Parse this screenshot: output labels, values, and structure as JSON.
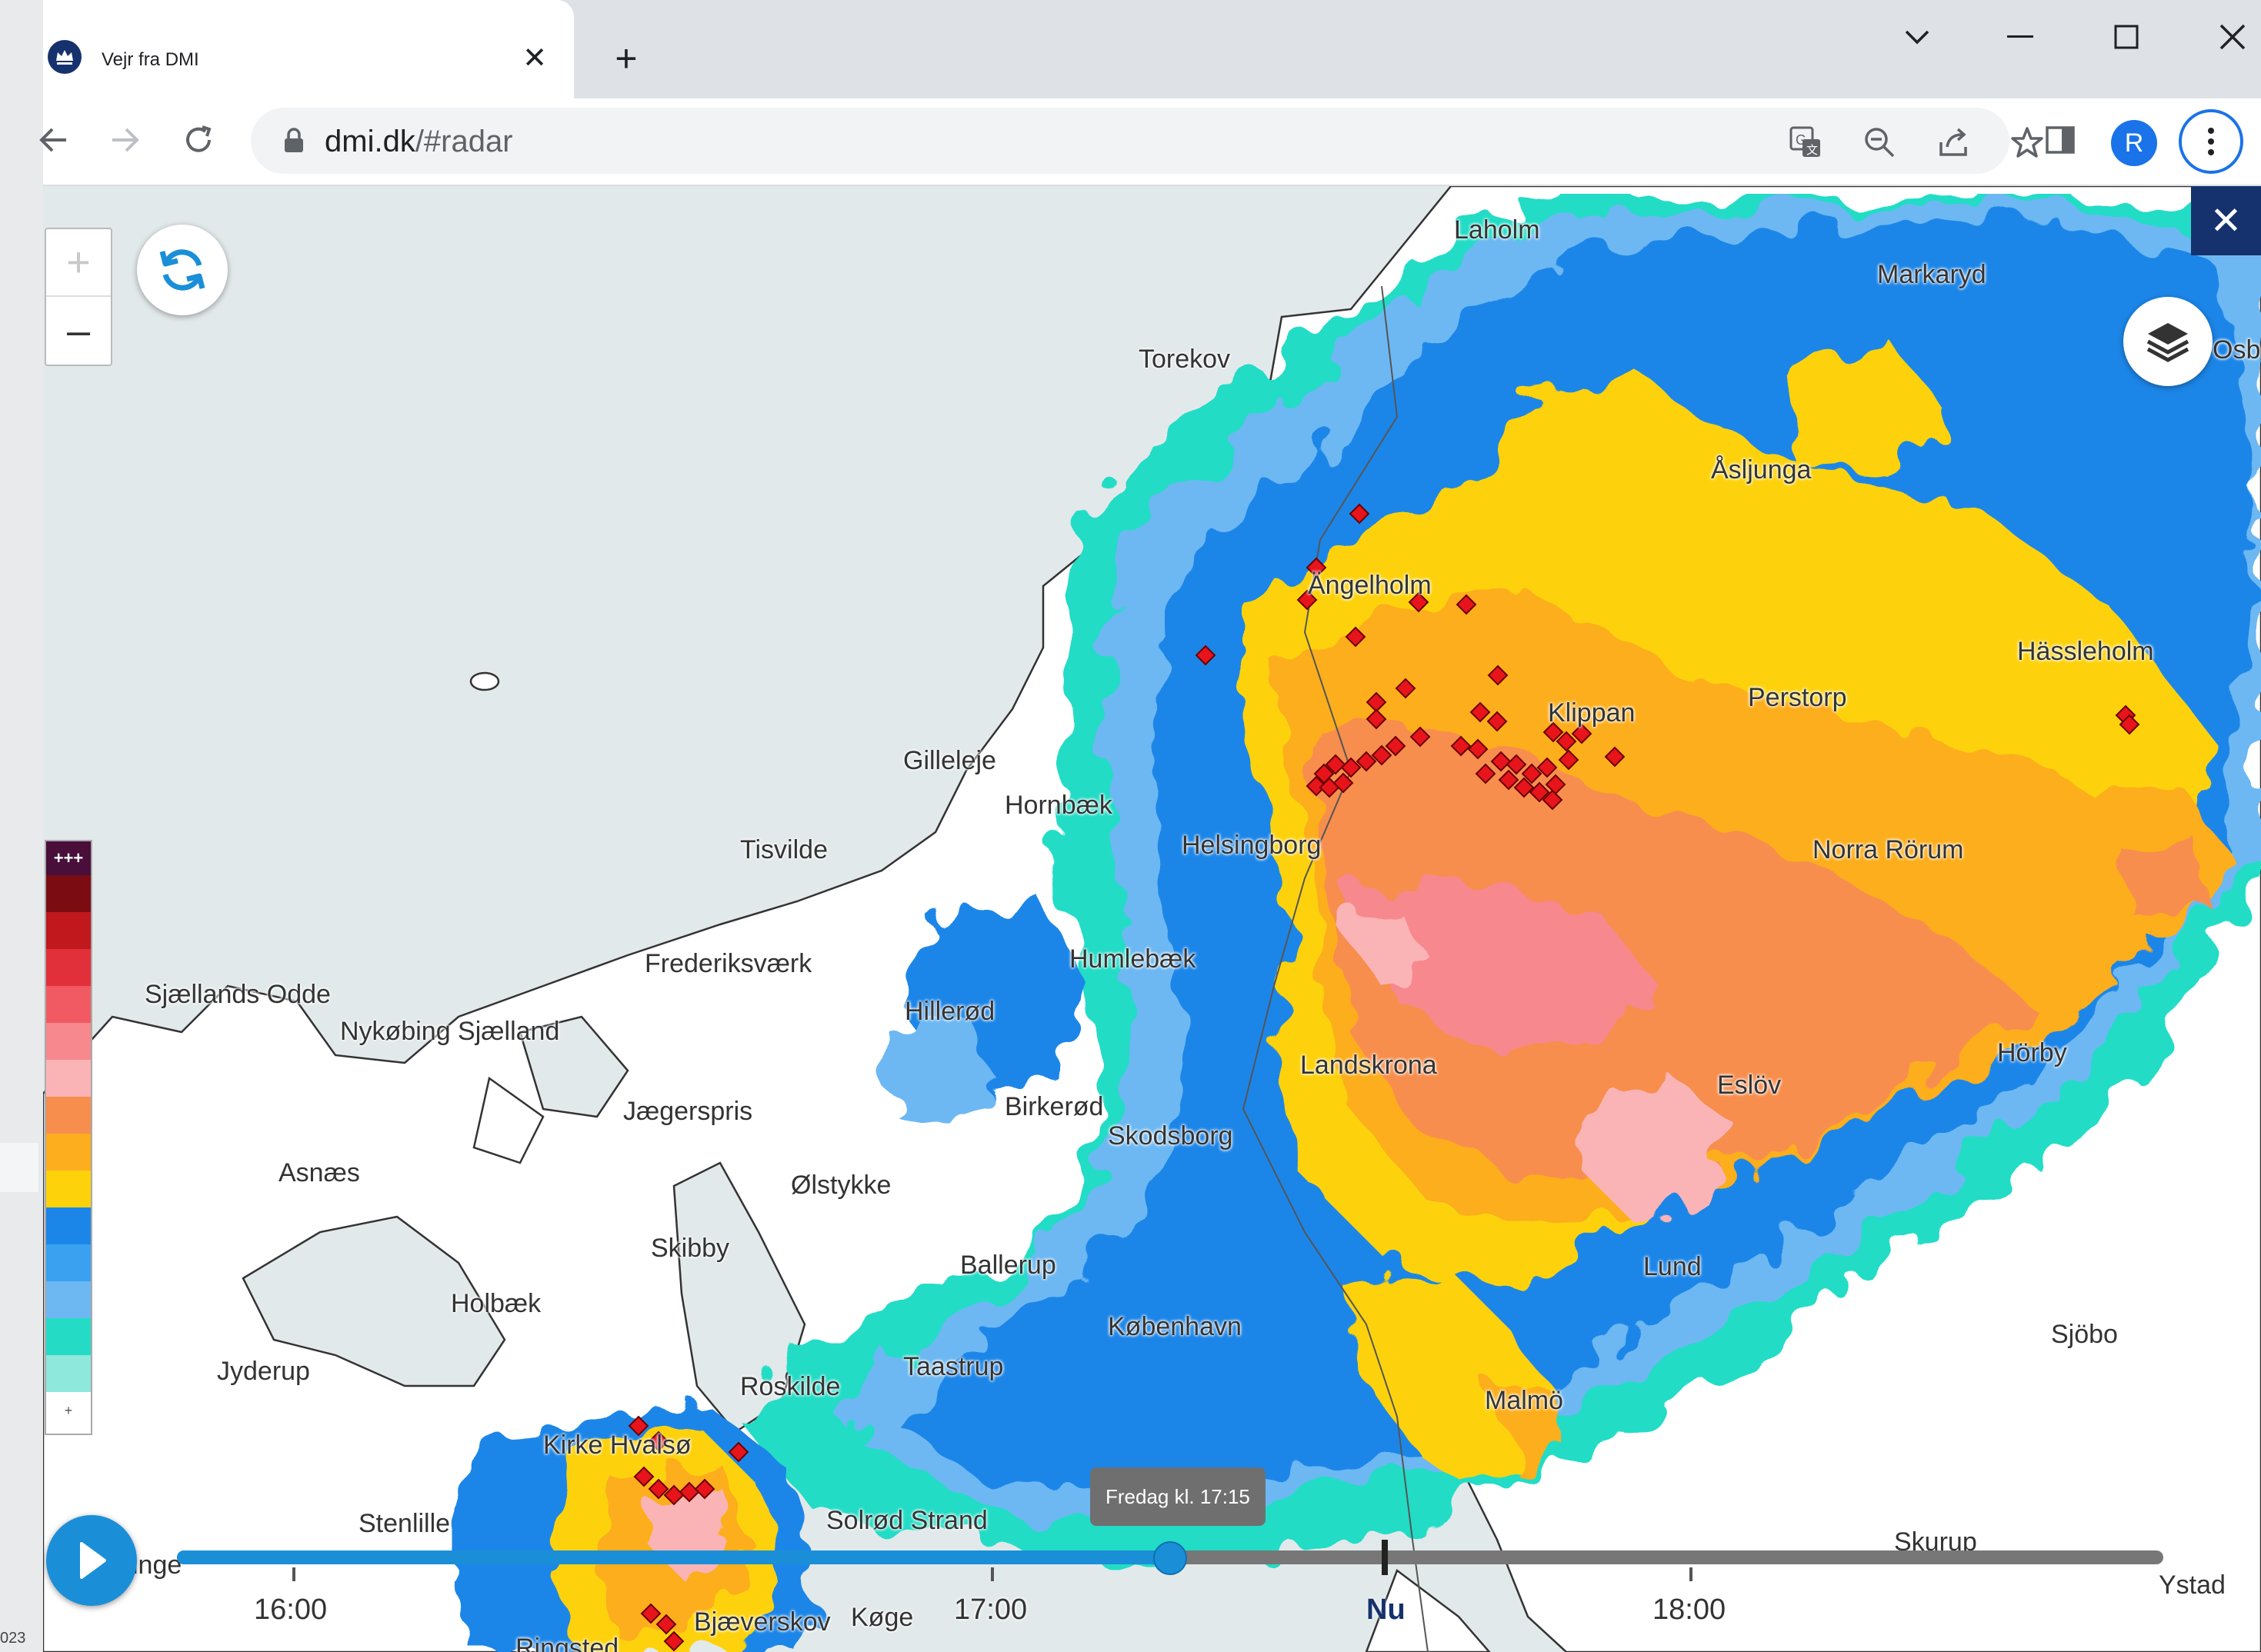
{
  "browser": {
    "tab_title": "Vejr fra DMI",
    "url_host": "dmi.dk",
    "url_path": "/#radar",
    "profile_initial": "R"
  },
  "left_edge": {
    "text": "023"
  },
  "map": {
    "places": [
      {
        "name": "Laholm"
      },
      {
        "name": "Markaryd"
      },
      {
        "name": "Torekov"
      },
      {
        "name": "Åsljunga"
      },
      {
        "name": "Ängelholm"
      },
      {
        "name": "Hässleholm"
      },
      {
        "name": "Klippan"
      },
      {
        "name": "Perstorp"
      },
      {
        "name": "Gilleleje"
      },
      {
        "name": "Hornbæk"
      },
      {
        "name": "Tisvilde"
      },
      {
        "name": "Helsingborg"
      },
      {
        "name": "Norra Rörum"
      },
      {
        "name": "Frederiksværk"
      },
      {
        "name": "Humlebæk"
      },
      {
        "name": "Sjællands Odde"
      },
      {
        "name": "Hillerød"
      },
      {
        "name": "Nykøbing Sjælland"
      },
      {
        "name": "Landskrona"
      },
      {
        "name": "Hörby"
      },
      {
        "name": "Eslöv"
      },
      {
        "name": "Jægerspris"
      },
      {
        "name": "Birkerød"
      },
      {
        "name": "Skodsborg"
      },
      {
        "name": "Asnæs"
      },
      {
        "name": "Ølstykke"
      },
      {
        "name": "Skibby"
      },
      {
        "name": "Ballerup"
      },
      {
        "name": "Lund"
      },
      {
        "name": "Holbæk"
      },
      {
        "name": "København"
      },
      {
        "name": "Sjöbo"
      },
      {
        "name": "Jyderup"
      },
      {
        "name": "Taastrup"
      },
      {
        "name": "Roskilde"
      },
      {
        "name": "Malmö"
      },
      {
        "name": "Kirke Hvalsø"
      },
      {
        "name": "Stenlille"
      },
      {
        "name": "Solrød Strand"
      },
      {
        "name": "Skurup"
      },
      {
        "name": "inge"
      },
      {
        "name": "Bjæverskov"
      },
      {
        "name": "Køge"
      },
      {
        "name": "Ystad"
      },
      {
        "name": "Ringsted"
      },
      {
        "name": "Osb"
      }
    ]
  },
  "controls": {
    "zoom_in": "+",
    "zoom_out": "–",
    "close": "✕"
  },
  "legend": {
    "top_label": "+++",
    "bottom_label": "+",
    "colors": [
      "#7a0c12",
      "#c0181d",
      "#e1303a",
      "#f15a63",
      "#f7888e",
      "#fbb4b6",
      "#f78e4e",
      "#fdae1f",
      "#fdd20a",
      "#1b86e8",
      "#3aa0f0",
      "#6db8f2",
      "#24dcc6",
      "#8fe8dc"
    ]
  },
  "timeline": {
    "labels": [
      "16:00",
      "17:00",
      "18:00"
    ],
    "now_label": "Nu",
    "tooltip": "Fredag kl. 17:15",
    "progress": 0.5
  },
  "colors": {
    "accent": "#1a8fd8",
    "dmi_navy": "#16326e",
    "chrome_blue": "#1a73e8"
  }
}
